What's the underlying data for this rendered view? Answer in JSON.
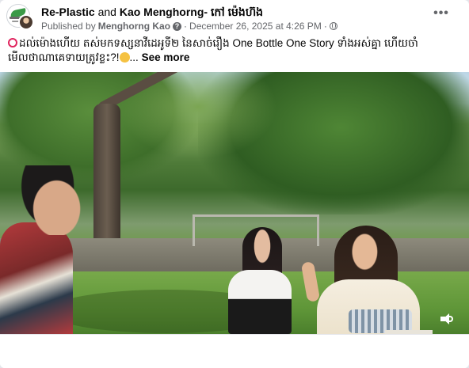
{
  "post": {
    "author_primary": "Re-Plastic",
    "conjunction": "and",
    "author_secondary": "Kao Menghorng- កៅ ម៉េងហ៊ង",
    "published_by_prefix": "Published by",
    "published_by_name": "Menghorng Kao",
    "separator": "·",
    "timestamp": "December 26, 2025 at 4:26 PM",
    "privacy_separator": "·",
    "more_icon_glyph": "•••"
  },
  "caption": {
    "line1": "ដល់ម៉ោងហើយ  តស់មកទស្សនាវីដេអូទី២ នៃសាច់រឿង One Bottle One Story ទាំងអស់គ្នា  ហើយចាំ",
    "line2": "មើលថាណាគេទាយត្រូវខ្លះ?!",
    "ellipsis": "...",
    "see_more": "See more"
  },
  "icons": {
    "alarm": "alarm-clock-icon",
    "thinking": "thinking-face-icon",
    "help": "question-circle-icon",
    "privacy": "globe-icon",
    "more": "more-horizontal-icon",
    "volume": "volume-icon"
  },
  "colors": {
    "secondary_text": "#65676b",
    "primary_text": "#050505",
    "background": "#ffffff"
  }
}
